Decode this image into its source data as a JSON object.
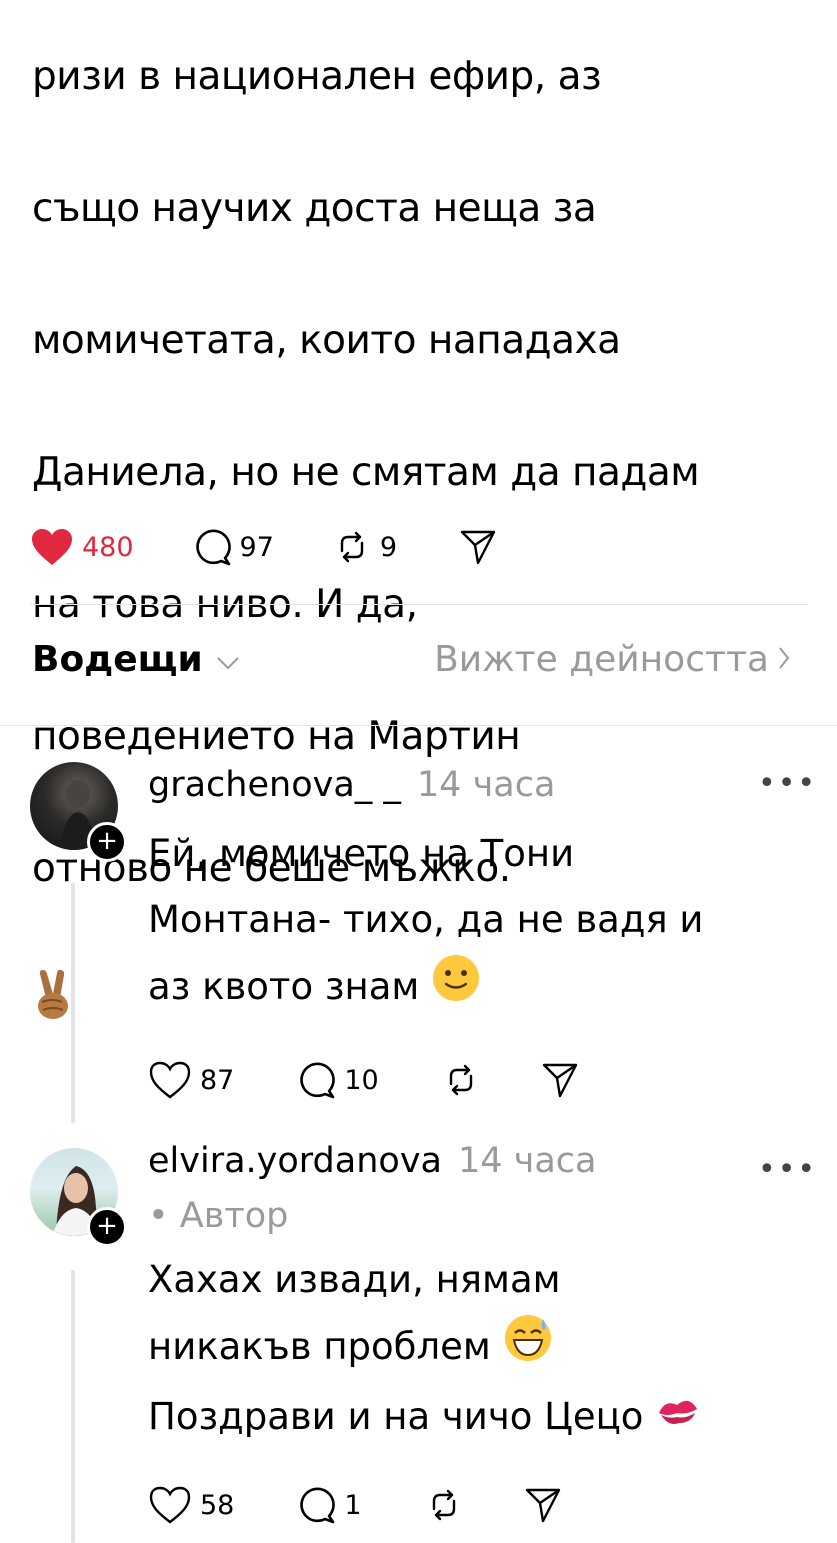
{
  "post": {
    "text_lines": [
      "ризи в национален ефир, аз",
      "също научих доста неща за",
      "момичетата, които нападаха",
      "Даниела, но не смятам да падам",
      "на това ниво. И да,",
      "поведението на Мартин",
      "отново не беше мъжко."
    ],
    "likes": "480",
    "comments": "97",
    "reposts": "9",
    "liked": true,
    "like_color": "#e0293f"
  },
  "sort": {
    "label": "Водещи",
    "activity_link": "Вижте дейността"
  },
  "replies": [
    {
      "username": "grachenova_ _",
      "time": "14 часа",
      "author_tag": "",
      "text_lines": [
        "Ей, момичето на Тони",
        "Монтана- тихо, да не вадя и",
        "аз квото знам"
      ],
      "likes": "87",
      "comments": "10",
      "reposts": ""
    },
    {
      "username": "elvira.yordanova",
      "time": "14 часа",
      "author_tag": "• Автор",
      "text_lines": [
        "Хахах извади, нямам",
        "никакъв проблем",
        "Поздрави и на чичо Цецо"
      ],
      "likes": "58",
      "comments": "1",
      "reposts": ""
    }
  ],
  "icons": {
    "heart": "heart-icon",
    "comment": "comment-icon",
    "repost": "repost-icon",
    "share": "share-icon",
    "more": "more-icon",
    "chevron_down": "chevron-down-icon",
    "chevron_right": "chevron-right-icon"
  }
}
